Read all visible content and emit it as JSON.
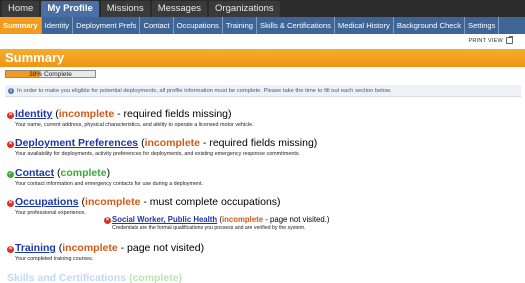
{
  "topnav": {
    "tabs": [
      "Home",
      "My Profile",
      "Missions",
      "Messages",
      "Organizations"
    ],
    "active": "My Profile"
  },
  "subnav": {
    "items": [
      "Summary",
      "Identity",
      "Deployment Prefs",
      "Contact",
      "Occupations",
      "Training",
      "Skills & Certifications",
      "Medical History",
      "Background Check",
      "Settings"
    ],
    "active": "Summary"
  },
  "print_view_label": "PRINT VIEW",
  "summary": {
    "title": "Summary",
    "progress_text": "38% Complete",
    "progress_value": 0.38,
    "info_text": "In order to make you eligible for potential deployments, all profile information must be complete. Please take the time to fill out each section below."
  },
  "sections": [
    {
      "title": "Identity",
      "open": "(",
      "status": "incomplete",
      "note": " - required fields missing",
      "close": ")",
      "ok": false,
      "desc": "Your name, current address, physical characteristics, and ability to operate a licensed motor vehicle."
    },
    {
      "title": "Deployment Preferences",
      "open": "(",
      "status": "incomplete",
      "note": " - required fields missing",
      "close": ")",
      "ok": false,
      "desc": "Your availability for deployments, activity preferences for deployments, and existing emergency response commitments."
    },
    {
      "title": "Contact",
      "open": "(",
      "status": "complete",
      "note": "",
      "close": ")",
      "ok": true,
      "desc": "Your contact information and emergency contacts for use during a deployment."
    },
    {
      "title": "Occupations",
      "open": "(",
      "status": "incomplete",
      "note": " - must complete occupations",
      "close": ")",
      "ok": false,
      "desc": "Your professional experience."
    },
    {
      "title": "Training",
      "open": "(",
      "status": "incomplete",
      "note": " - page not visited",
      "close": ")",
      "ok": false,
      "desc": "Your completed training courses."
    }
  ],
  "subsection": {
    "title": "Social Worker, Public Health",
    "open": "(",
    "status": "incomplete",
    "note": " - page not visited.",
    "close": ")",
    "desc": "Credentials are the formal qualifications you possess and are verified by the system."
  },
  "faded_section": {
    "title": "Skills and Certifications",
    "status": "(complete)"
  },
  "colors": {
    "accent_orange": "#f39b1f",
    "nav_blue": "#3f6496",
    "link_blue": "#1c37a8",
    "incomplete": "#d05a1a",
    "complete": "#3ca836"
  }
}
